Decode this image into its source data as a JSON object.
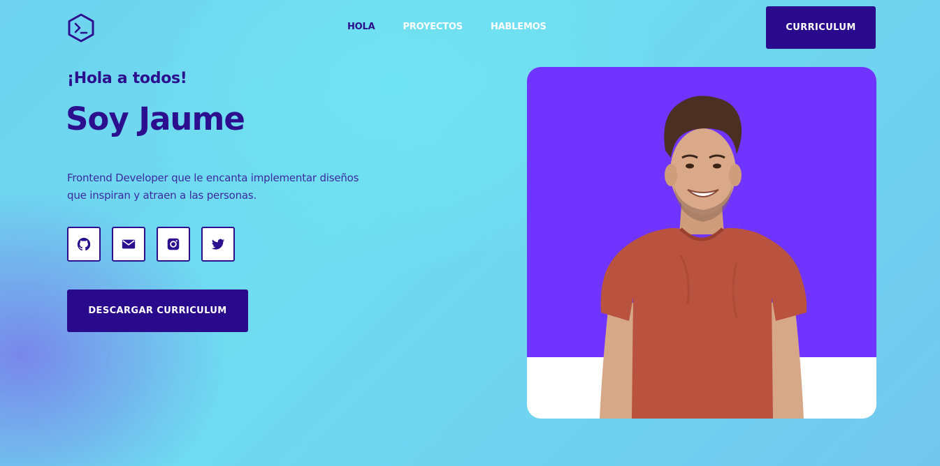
{
  "header": {
    "logo_icon": "terminal-hexagon-icon",
    "nav": [
      {
        "label": "HOLA",
        "active": true
      },
      {
        "label": "PROYECTOS",
        "active": false
      },
      {
        "label": "HABLEMOS",
        "active": false
      }
    ],
    "cta_label": "CURRICULUM"
  },
  "hero": {
    "greeting": "¡Hola a todos!",
    "name": "Soy Jaume",
    "description": "Frontend Developer que le encanta implementar diseños que inspiran y atraen a las personas.",
    "socials": [
      {
        "icon": "github-icon"
      },
      {
        "icon": "mail-icon"
      },
      {
        "icon": "instagram-icon"
      },
      {
        "icon": "twitter-icon"
      }
    ],
    "download_label": "DESCARGAR CURRICULUM"
  },
  "colors": {
    "primary": "#2a0a8c",
    "photo_bg": "#7034ff",
    "white": "#ffffff"
  }
}
